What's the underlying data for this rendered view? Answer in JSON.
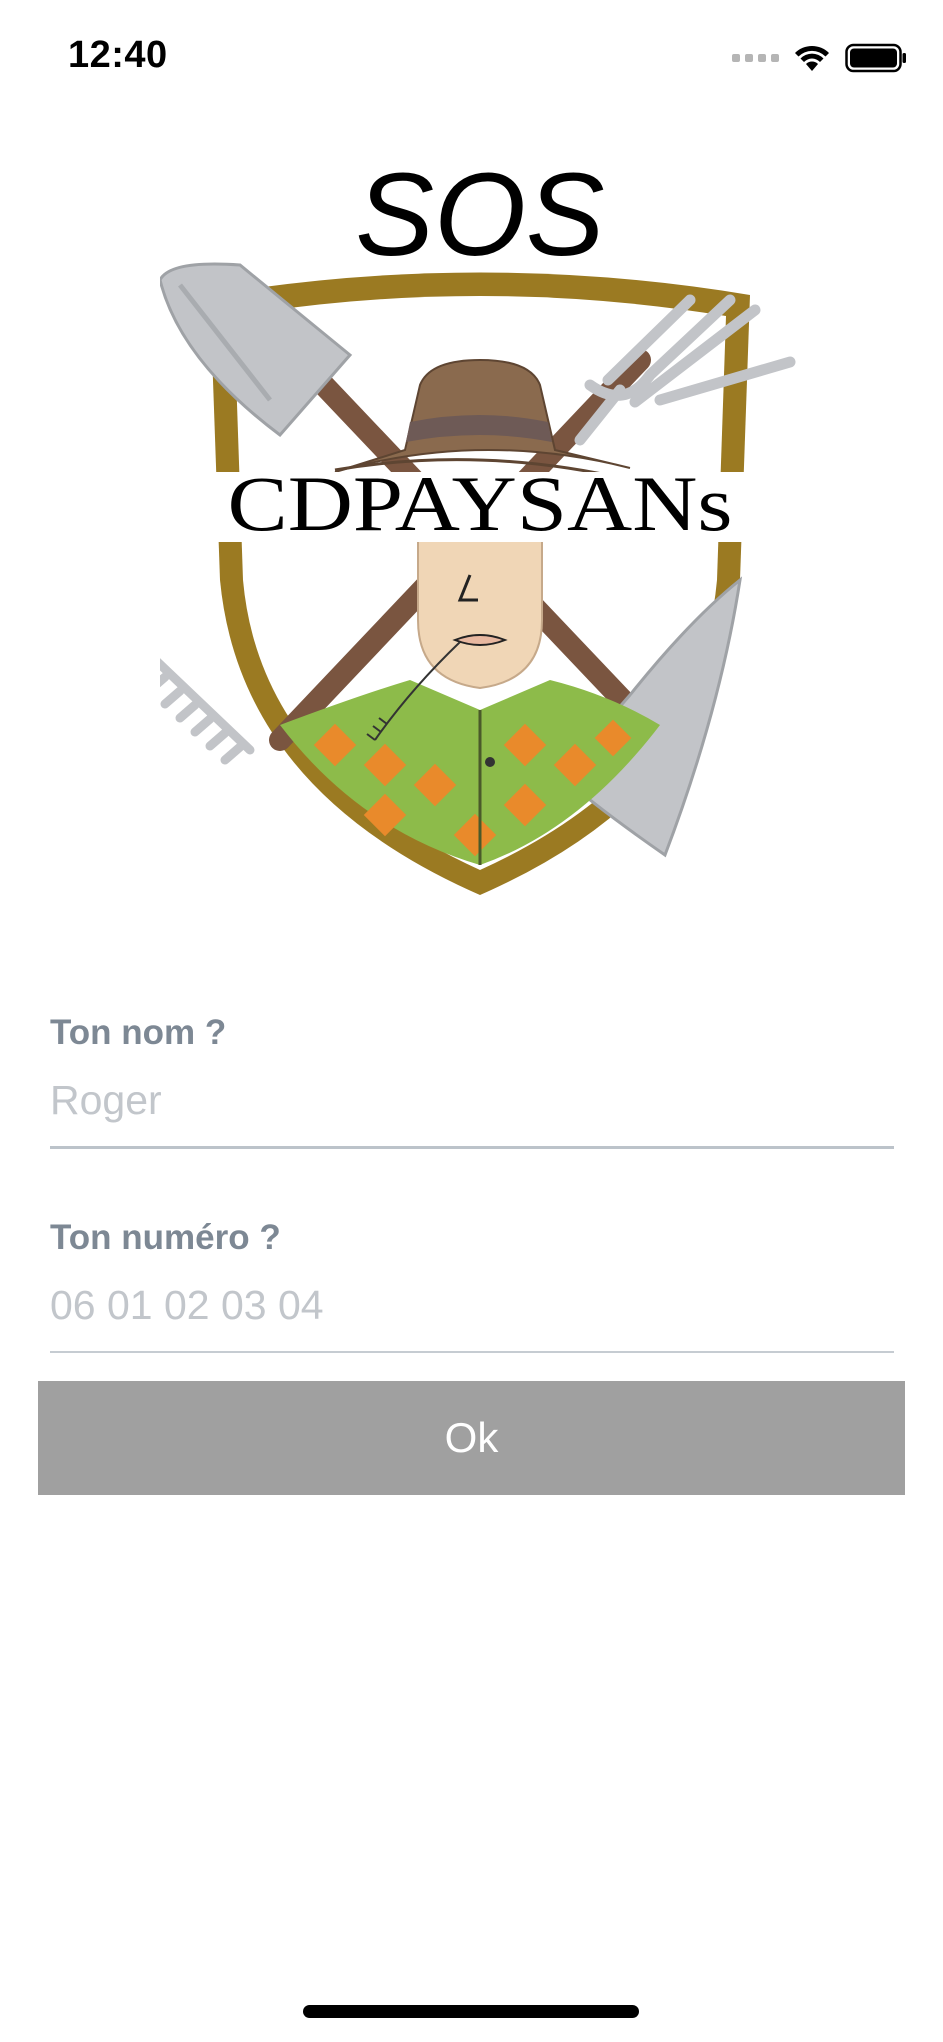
{
  "status_bar": {
    "time": "12:40",
    "icons": [
      "cellular-signal-icon",
      "wifi-icon",
      "battery-icon"
    ]
  },
  "logo": {
    "heading": "SOS",
    "wordmark": "CDPAYSANs"
  },
  "form": {
    "name_field": {
      "label": "Ton nom ?",
      "placeholder": "Roger",
      "value": ""
    },
    "phone_field": {
      "label": "Ton numéro ?",
      "placeholder": "06 01 02 03 04",
      "value": ""
    },
    "submit_label": "Ok"
  },
  "colors": {
    "button_bg": "#a0a0a0",
    "label": "#7d8894",
    "placeholder": "#c2c6cb",
    "shield_border": "#9b7a22"
  }
}
